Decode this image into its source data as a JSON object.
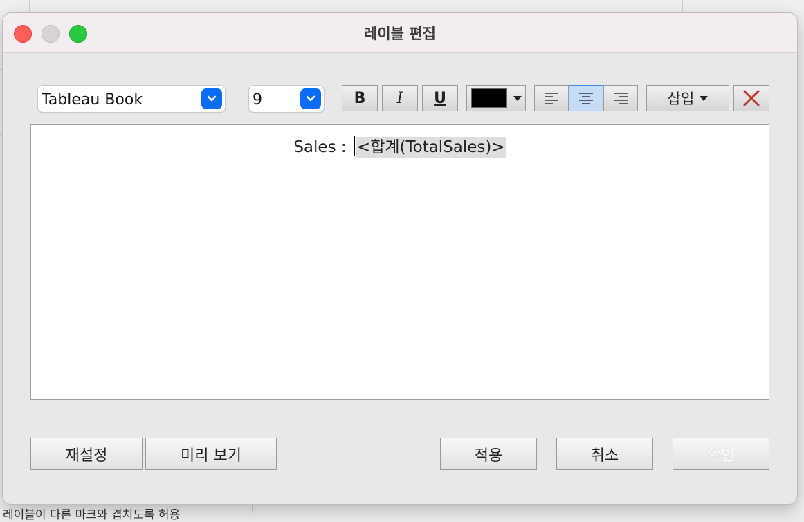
{
  "background": {
    "bottom_text": "레이블이 다른 마크와 겹치도록 허용"
  },
  "dialog": {
    "title": "레이블 편집",
    "window_controls": [
      "close",
      "minimize",
      "zoom"
    ]
  },
  "toolbar": {
    "font": {
      "value": "Tableau Book",
      "icon": "chevron-down-icon"
    },
    "size": {
      "value": "9",
      "icon": "chevron-down-icon"
    },
    "bold_label": "B",
    "italic_label": "I",
    "underline_label": "U",
    "text_color": "#000000",
    "alignment_selected": "center",
    "insert_label": "삽입",
    "clear_icon": "close-x-icon",
    "clear_color": "#c0392b",
    "accent_color": "#0a6cf5"
  },
  "editor": {
    "prefix": "Sales : ",
    "field": "<합계(TotalSales)>"
  },
  "buttons": {
    "reset": "재설정",
    "preview": "미리 보기",
    "apply": "적용",
    "cancel": "취소",
    "ok": "확인"
  }
}
